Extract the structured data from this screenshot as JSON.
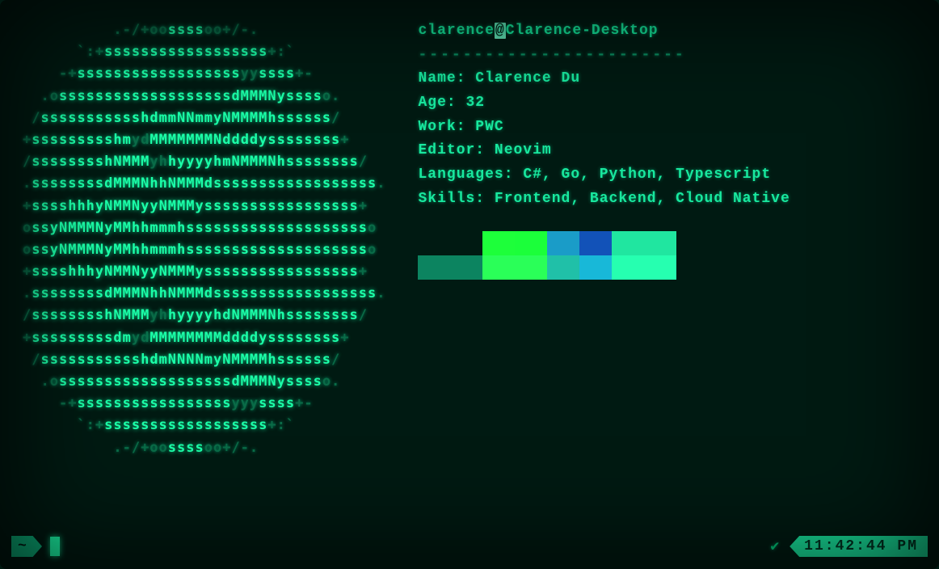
{
  "ascii": {
    "lines": [
      {
        "pre": "          ",
        "dim": ".-/+oo",
        "brt": "ssss",
        "dim2": "oo+/-.",
        "post": ""
      },
      {
        "pre": "      ",
        "dim": "`:+",
        "brt": "ssssssssssssssssss",
        "dim2": "+:`",
        "post": ""
      },
      {
        "pre": "    ",
        "dim": "-+",
        "brt": "ssssssssssssssssss",
        "mid": "yy",
        "brt2": "ssss",
        "dim2": "+-",
        "post": ""
      },
      {
        "pre": "  ",
        "dim": ".o",
        "brt": "sssssssssssssssssss",
        "bold": "dMMMNy",
        "brt2": "ssss",
        "dim2": "o.",
        "post": ""
      },
      {
        "pre": " ",
        "dim": "/",
        "brt": "sssssssssss",
        "bold": "hdmmNNmmyNMMMMh",
        "brt2": "ssssss",
        "dim2": "/",
        "post": ""
      },
      {
        "pre": "",
        "dim": "+",
        "brt": "sssssssss",
        "bold": "hm",
        "mid": "yd",
        "bold2": "MMMMMMMNddddy",
        "brt2": "ssssssss",
        "dim2": "+",
        "post": ""
      },
      {
        "pre": "",
        "dim": "/",
        "brt": "ssssssss",
        "bold": "hNMMM",
        "mid": "yh",
        "bold2": "hyyyyhmNMMMNh",
        "brt2": "ssssssss",
        "dim2": "/",
        "post": ""
      },
      {
        "pre": "",
        "dim": ".",
        "brt": "ssssssss",
        "bold": "dMMMNh",
        "brt2": "ssssssssss",
        "bold2": "hNMMMd",
        "brt3": "ssssssss",
        "dim2": ".",
        "post": ""
      },
      {
        "pre": "",
        "dim": "+",
        "brt": "ssss",
        "bold": "hhhyNMMNy",
        "brt2": "ssssssssss",
        "bold2": "yNMMMy",
        "brt3": "sssssss",
        "dim2": "+",
        "post": ""
      },
      {
        "pre": "",
        "dim": "o",
        "brt": "ss",
        "bold": "yNMMMNyMMh",
        "brt2": "ssssssssssss",
        "bold2": "hmmmh",
        "brt3": "ssssssss",
        "dim2": "o",
        "post": ""
      },
      {
        "pre": "",
        "dim": "o",
        "brt": "ss",
        "bold": "yNMMMNyMMh",
        "brt2": "sssssssssssss",
        "bold2": "hmmmh",
        "brt3": "sssssss",
        "dim2": "o",
        "post": ""
      },
      {
        "pre": "",
        "dim": "+",
        "brt": "ssss",
        "bold": "hhhyNMMNy",
        "brt2": "ssssssssss",
        "bold2": "yNMMMy",
        "brt3": "sssssss",
        "dim2": "+",
        "post": ""
      },
      {
        "pre": "",
        "dim": ".",
        "brt": "ssssssss",
        "bold": "dMMMNh",
        "brt2": "ssssssssss",
        "bold2": "hNMMMd",
        "brt3": "ssssssss",
        "dim2": ".",
        "post": ""
      },
      {
        "pre": "",
        "dim": "/",
        "brt": "ssssssss",
        "bold": "hNMMM",
        "mid": "yh",
        "bold2": "hyyyyhdNMMMNh",
        "brt2": "ssssssss",
        "dim2": "/",
        "post": ""
      },
      {
        "pre": "",
        "dim": "+",
        "brt": "sssssssss",
        "bold": "dm",
        "mid": "yd",
        "bold2": "MMMMMMMMddddy",
        "brt2": "ssssssss",
        "dim2": "+",
        "post": ""
      },
      {
        "pre": " ",
        "dim": "/",
        "brt": "sssssssssss",
        "bold": "hdmNNNNmyNMMMMh",
        "brt2": "ssssss",
        "dim2": "/",
        "post": ""
      },
      {
        "pre": "  ",
        "dim": ".o",
        "brt": "sssssssssssssssssss",
        "bold": "dMMMNy",
        "brt2": "ssss",
        "dim2": "o.",
        "post": ""
      },
      {
        "pre": "    ",
        "dim": "-+",
        "brt": "sssssssssssssssss",
        "mid": "yyy",
        "brt2": "ssss",
        "dim2": "+-",
        "post": ""
      },
      {
        "pre": "      ",
        "dim": "`:+",
        "brt": "ssssssssssssssssss",
        "dim2": "+:`",
        "post": ""
      },
      {
        "pre": "          ",
        "dim": ".-/+oo",
        "brt": "ssss",
        "dim2": "oo+/-.",
        "post": ""
      }
    ]
  },
  "hostline": {
    "user": "clarence",
    "at": "@",
    "host": "Clarence-Desktop"
  },
  "divider": "------------------------",
  "info": [
    {
      "key": "Name",
      "val": "Clarence Du"
    },
    {
      "key": "Age",
      "val": "32"
    },
    {
      "key": "Work",
      "val": "PWC"
    },
    {
      "key": "Editor",
      "val": "Neovim"
    },
    {
      "key": "Languages",
      "val": "C#, Go, Python, Typescript"
    },
    {
      "key": "Skills",
      "val": "Frontend, Backend, Cloud Native"
    }
  ],
  "swatches": {
    "row1": [
      "#00000000",
      "#00000000",
      "#1dff3a",
      "#1bff3a",
      "#1a9cc8",
      "#1252b8",
      "#20e6a0",
      "#20e6a0"
    ],
    "row2": [
      "#0c8460",
      "#0c8460",
      "#2aff58",
      "#2aff58",
      "#20c0a8",
      "#18b8d8",
      "#26ffb0",
      "#26ffb0"
    ]
  },
  "status": {
    "prompt_symbol": "~",
    "check_symbol": "✔",
    "clock": "11:42:44 PM"
  }
}
